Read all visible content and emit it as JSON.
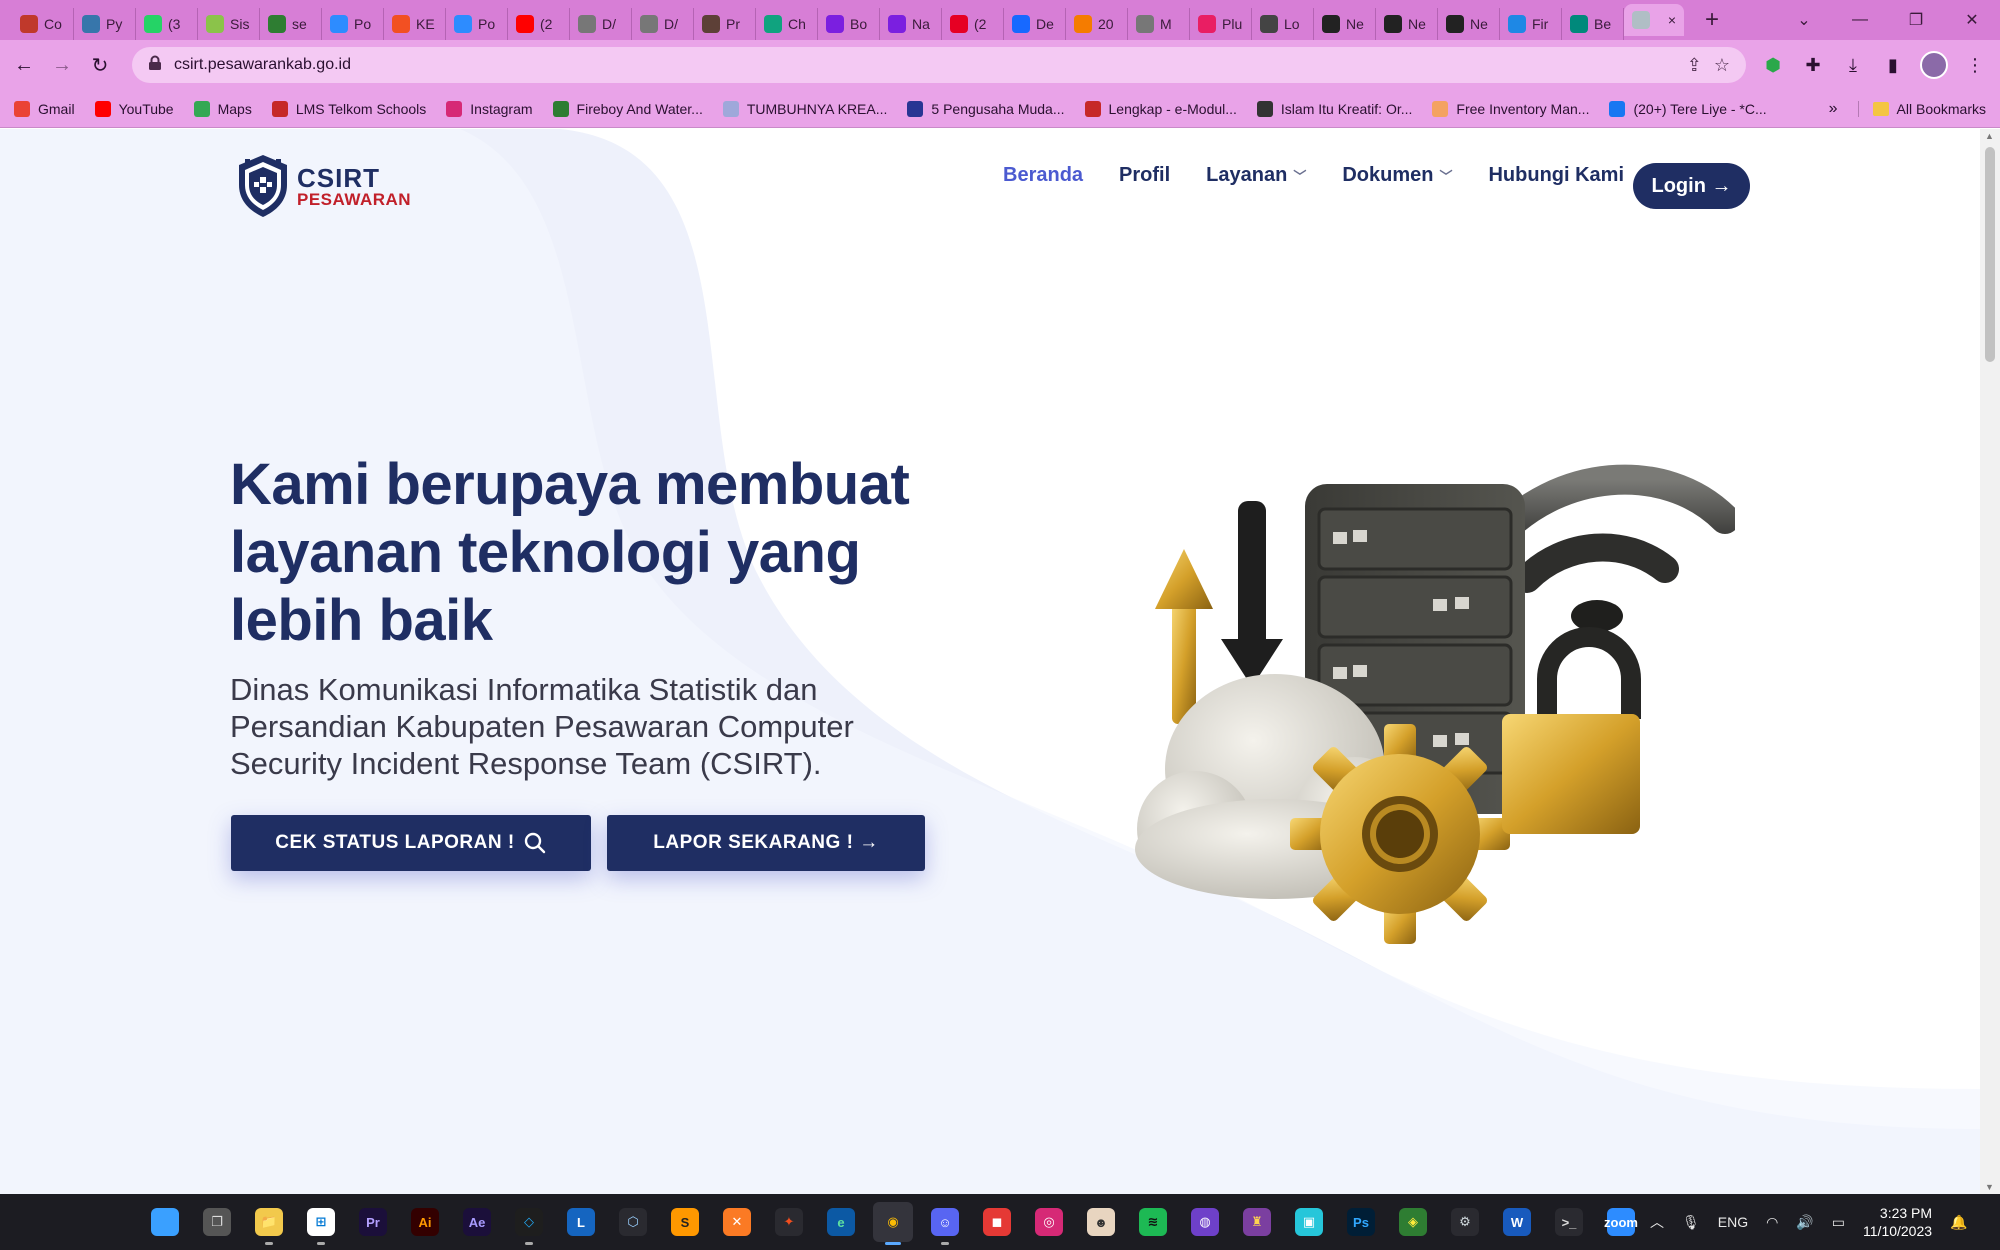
{
  "browser": {
    "tabs": [
      {
        "label": "Co",
        "color": "#c0392b"
      },
      {
        "label": "Py",
        "color": "#3776ab"
      },
      {
        "label": "(3",
        "color": "#25d366"
      },
      {
        "label": "Sis",
        "color": "#8bc34a"
      },
      {
        "label": "se",
        "color": "#2e7d32"
      },
      {
        "label": "Po",
        "color": "#2d8cff"
      },
      {
        "label": "KE",
        "color": "#f25022"
      },
      {
        "label": "Po",
        "color": "#2d8cff"
      },
      {
        "label": "(2",
        "color": "#ff0000"
      },
      {
        "label": "D/",
        "color": "#777777"
      },
      {
        "label": "D/",
        "color": "#777777"
      },
      {
        "label": "Pr",
        "color": "#5d4037"
      },
      {
        "label": "Ch",
        "color": "#10a37f"
      },
      {
        "label": "Bo",
        "color": "#7b1fe0"
      },
      {
        "label": "Na",
        "color": "#7b1fe0"
      },
      {
        "label": "(2",
        "color": "#e60023"
      },
      {
        "label": "De",
        "color": "#1769ff"
      },
      {
        "label": "20",
        "color": "#f57c00"
      },
      {
        "label": "M",
        "color": "#777777"
      },
      {
        "label": "Plu",
        "color": "#e91e63"
      },
      {
        "label": "Lo",
        "color": "#444444"
      },
      {
        "label": "Ne",
        "color": "#222222"
      },
      {
        "label": "Ne",
        "color": "#222222"
      },
      {
        "label": "Ne",
        "color": "#222222"
      },
      {
        "label": "Fir",
        "color": "#1e88e5"
      },
      {
        "label": "Be",
        "color": "#00897b"
      }
    ],
    "active_tab": {
      "label": "",
      "close": "×"
    },
    "new_tab": "+",
    "url": "csirt.pesawarankab.go.id"
  },
  "bookmarks": [
    {
      "label": "Gmail",
      "color": "#ea4335"
    },
    {
      "label": "YouTube",
      "color": "#ff0000"
    },
    {
      "label": "Maps",
      "color": "#34a853"
    },
    {
      "label": "LMS Telkom Schools",
      "color": "#c62828"
    },
    {
      "label": "Instagram",
      "color": "#d62976"
    },
    {
      "label": "Fireboy And Water...",
      "color": "#2e7d32"
    },
    {
      "label": "TUMBUHNYA KREA...",
      "color": "#9fa8da"
    },
    {
      "label": "5 Pengusaha Muda...",
      "color": "#283593"
    },
    {
      "label": "Lengkap - e-Modul...",
      "color": "#c62828"
    },
    {
      "label": "Islam Itu Kreatif: Or...",
      "color": "#333333"
    },
    {
      "label": "Free Inventory Man...",
      "color": "#f4a261"
    },
    {
      "label": "(20+) Tere Liye - *C...",
      "color": "#1877f2"
    }
  ],
  "bookmarks_more": "»",
  "all_bookmarks": "All Bookmarks",
  "site": {
    "logo_top": "CSIRT",
    "logo_bottom": "PESAWARAN",
    "nav": {
      "beranda": "Beranda",
      "profil": "Profil",
      "layanan": "Layanan",
      "dokumen": "Dokumen",
      "hubungi": "Hubungi Kami"
    },
    "login": "Login →",
    "hero_title": "Kami berupaya membuat layanan teknologi yang lebih baik",
    "hero_subtitle": "Dinas Komunikasi Informatika Statistik dan Persandian Kabupaten Pesawaran Computer Security Incident Response Team (CSIRT).",
    "cta_status": "CEK STATUS LAPORAN !",
    "cta_lapor": "LAPOR SEKARANG ! →"
  },
  "taskbar": {
    "apps": [
      {
        "name": "start",
        "label": "⊞",
        "color": "#3aa0ff",
        "fg": "#3aa0ff"
      },
      {
        "name": "task-view",
        "label": "❐",
        "color": "#555",
        "fg": "#ddd"
      },
      {
        "name": "file-explorer",
        "label": "📁",
        "color": "#f2c94c",
        "fg": "#7a5a00"
      },
      {
        "name": "store",
        "label": "⊞",
        "color": "#ffffff",
        "fg": "#0078d4"
      },
      {
        "name": "premiere",
        "label": "Pr",
        "color": "#1b0f3a",
        "fg": "#b4a0ff"
      },
      {
        "name": "illustrator",
        "label": "Ai",
        "color": "#330000",
        "fg": "#ff9a00"
      },
      {
        "name": "after-effects",
        "label": "Ae",
        "color": "#1b0f3a",
        "fg": "#a99bff"
      },
      {
        "name": "vscode",
        "label": "◇",
        "color": "#1e1e1e",
        "fg": "#23a9f2"
      },
      {
        "name": "lens",
        "label": "L",
        "color": "#1565c0",
        "fg": "#ffffff"
      },
      {
        "name": "cube-app",
        "label": "⬡",
        "color": "#2a2a30",
        "fg": "#9ad0ff"
      },
      {
        "name": "sublime",
        "label": "S",
        "color": "#ff9800",
        "fg": "#222"
      },
      {
        "name": "xampp",
        "label": "✕",
        "color": "#fb7a24",
        "fg": "#fff"
      },
      {
        "name": "figma",
        "label": "✦",
        "color": "#2a2a30",
        "fg": "#f24e1e"
      },
      {
        "name": "edge",
        "label": "e",
        "color": "#0c59a4",
        "fg": "#5ee0a0"
      },
      {
        "name": "chrome",
        "label": "◉",
        "color": "#34343c",
        "fg": "#fbbc05"
      },
      {
        "name": "discord",
        "label": "☺",
        "color": "#5865f2",
        "fg": "#fff"
      },
      {
        "name": "roblox-app",
        "label": "◼",
        "color": "#e53935",
        "fg": "#fff"
      },
      {
        "name": "instagram",
        "label": "◎",
        "color": "#d62976",
        "fg": "#fff"
      },
      {
        "name": "photo-app",
        "label": "☻",
        "color": "#e8d5c0",
        "fg": "#333"
      },
      {
        "name": "spotify",
        "label": "≋",
        "color": "#1db954",
        "fg": "#111"
      },
      {
        "name": "github",
        "label": "◍",
        "color": "#6e40c9",
        "fg": "#fff"
      },
      {
        "name": "game-app",
        "label": "♜",
        "color": "#7b3fa0",
        "fg": "#ffd54f"
      },
      {
        "name": "notes-app",
        "label": "▣",
        "color": "#26c6da",
        "fg": "#fff"
      },
      {
        "name": "photoshop",
        "label": "Ps",
        "color": "#001e36",
        "fg": "#31a8ff"
      },
      {
        "name": "maps-app",
        "label": "◈",
        "color": "#2e7d32",
        "fg": "#ffeb3b"
      },
      {
        "name": "settings",
        "label": "⚙",
        "color": "#2a2a30",
        "fg": "#cfd8dc"
      },
      {
        "name": "word",
        "label": "W",
        "color": "#185abd",
        "fg": "#fff"
      },
      {
        "name": "terminal",
        "label": ">_",
        "color": "#2a2a30",
        "fg": "#ddd"
      },
      {
        "name": "zoom",
        "label": "zoom",
        "color": "#2d8cff",
        "fg": "#fff"
      }
    ],
    "lang": "ENG",
    "time": "3:23 PM",
    "date": "11/10/2023"
  }
}
